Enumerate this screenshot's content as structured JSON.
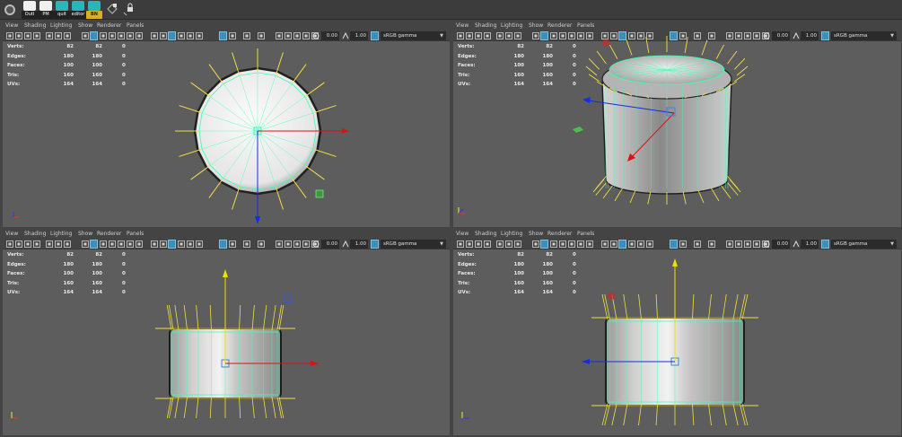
{
  "shelf": {
    "items": [
      {
        "label": "Outl",
        "color": "#f0f0f0"
      },
      {
        "label": "PM",
        "color": "#f0f0f0"
      },
      {
        "label": "quit",
        "color": "#2bb5b8"
      },
      {
        "label": "editor",
        "color": "#2bb5b8"
      },
      {
        "label": "BN",
        "color": "#2bb5b8"
      }
    ]
  },
  "panes": [
    {
      "menu": [
        "View",
        "Shading",
        "Lighting",
        "Show",
        "Renderer",
        "Panels"
      ],
      "exposure": "0.00",
      "gamma": "1.00",
      "color_space": "sRGB gamma",
      "stats": [
        {
          "label": "Verts:",
          "a": "82",
          "b": "82",
          "c": "0"
        },
        {
          "label": "Edges:",
          "a": "180",
          "b": "180",
          "c": "0"
        },
        {
          "label": "Faces:",
          "a": "100",
          "b": "100",
          "c": "0"
        },
        {
          "label": "Tris:",
          "a": "160",
          "b": "160",
          "c": "0"
        },
        {
          "label": "UVs:",
          "a": "164",
          "b": "164",
          "c": "0"
        }
      ]
    },
    {
      "menu": [
        "View",
        "Shading",
        "Lighting",
        "Show",
        "Renderer",
        "Panels"
      ],
      "exposure": "0.00",
      "gamma": "1.00",
      "color_space": "sRGB gamma",
      "stats": [
        {
          "label": "Verts:",
          "a": "82",
          "b": "82",
          "c": "0"
        },
        {
          "label": "Edges:",
          "a": "180",
          "b": "180",
          "c": "0"
        },
        {
          "label": "Faces:",
          "a": "100",
          "b": "100",
          "c": "0"
        },
        {
          "label": "Tris:",
          "a": "160",
          "b": "160",
          "c": "0"
        },
        {
          "label": "UVs:",
          "a": "164",
          "b": "164",
          "c": "0"
        }
      ]
    },
    {
      "menu": [
        "View",
        "Shading",
        "Lighting",
        "Show",
        "Renderer",
        "Panels"
      ],
      "exposure": "0.00",
      "gamma": "1.00",
      "color_space": "sRGB gamma",
      "stats": [
        {
          "label": "Verts:",
          "a": "82",
          "b": "82",
          "c": "0"
        },
        {
          "label": "Edges:",
          "a": "180",
          "b": "180",
          "c": "0"
        },
        {
          "label": "Faces:",
          "a": "100",
          "b": "100",
          "c": "0"
        },
        {
          "label": "Tris:",
          "a": "160",
          "b": "160",
          "c": "0"
        },
        {
          "label": "UVs:",
          "a": "164",
          "b": "164",
          "c": "0"
        }
      ]
    },
    {
      "menu": [
        "View",
        "Shading",
        "Lighting",
        "Show",
        "Renderer",
        "Panels"
      ],
      "exposure": "0.00",
      "gamma": "1.00",
      "color_space": "sRGB gamma",
      "stats": [
        {
          "label": "Verts:",
          "a": "82",
          "b": "82",
          "c": "0"
        },
        {
          "label": "Edges:",
          "a": "180",
          "b": "180",
          "c": "0"
        },
        {
          "label": "Faces:",
          "a": "100",
          "b": "100",
          "c": "0"
        },
        {
          "label": "Tris:",
          "a": "160",
          "b": "160",
          "c": "0"
        },
        {
          "label": "UVs:",
          "a": "164",
          "b": "164",
          "c": "0"
        }
      ]
    }
  ],
  "icons": {
    "shelf_gear": "gear-icon",
    "toolbar": [
      "camera-icon",
      "grid-icon",
      "wireframe-icon",
      "smooth-shade-icon",
      "texture-icon",
      "light-icon",
      "isolate-icon",
      "xray-icon",
      "exposure-icon",
      "gamma-icon",
      "color-space-icon"
    ]
  },
  "colors": {
    "viewport_bg": "#5d5d5d",
    "wire_highlight": "#3dffb0",
    "normal_lines": "#f0e040",
    "axis_x": "#e01010",
    "axis_y": "#f0e000",
    "axis_z": "#1030e0",
    "toolbar_active": "#3b8fb8"
  }
}
